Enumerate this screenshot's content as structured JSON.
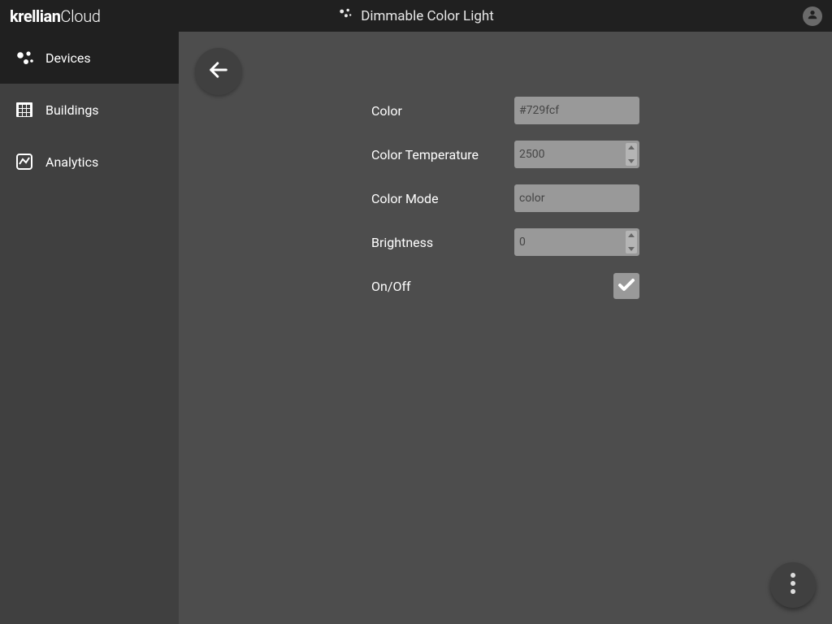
{
  "brand": {
    "name_bold": "krellian",
    "name_light": "Cloud"
  },
  "header": {
    "title": "Dimmable Color Light"
  },
  "sidebar": {
    "items": [
      {
        "label": "Devices",
        "active": true
      },
      {
        "label": "Buildings",
        "active": false
      },
      {
        "label": "Analytics",
        "active": false
      }
    ]
  },
  "form": {
    "color": {
      "label": "Color",
      "value": "#729fcf"
    },
    "color_temperature": {
      "label": "Color Temperature",
      "value": "2500"
    },
    "color_mode": {
      "label": "Color Mode",
      "value": "color"
    },
    "brightness": {
      "label": "Brightness",
      "value": "0"
    },
    "on_off": {
      "label": "On/Off",
      "checked": true
    }
  }
}
